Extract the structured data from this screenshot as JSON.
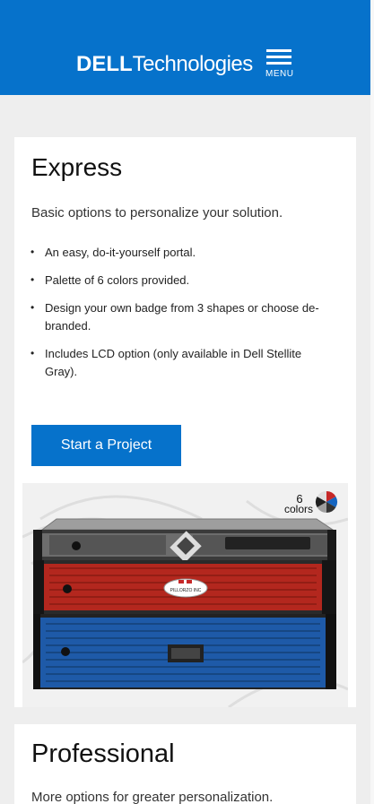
{
  "header": {
    "logo_dell": "DELL",
    "logo_tech": "Technologies",
    "menu_label": "MENU",
    "bg_color": "#0672cb"
  },
  "express": {
    "title": "Express",
    "intro": "Basic options to personalize your solution.",
    "bullets": [
      "An easy, do-it-yourself portal.",
      "Palette of 6 colors provided.",
      "Design your own badge from 3 shapes or choose de-branded.",
      "Includes LCD option (only available in Dell Stellite Gray)."
    ],
    "cta_label": "Start a Project",
    "image": {
      "colors_count": "6",
      "colors_word": "colors",
      "badge_text": "PILLORZO INC"
    }
  },
  "professional": {
    "title": "Professional",
    "intro": "More options for greater personalization."
  }
}
